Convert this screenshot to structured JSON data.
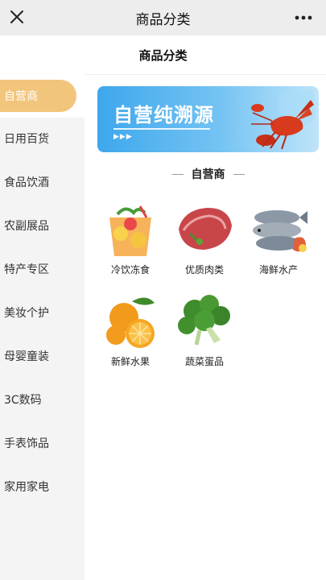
{
  "topbar": {
    "title": "商品分类"
  },
  "header": {
    "title": "商品分类"
  },
  "sidebar": {
    "items": [
      {
        "label": "自营商",
        "active": true
      },
      {
        "label": "日用百货"
      },
      {
        "label": "食品饮酒"
      },
      {
        "label": "农副展品"
      },
      {
        "label": "特产专区"
      },
      {
        "label": "美妆个护"
      },
      {
        "label": "母婴童装"
      },
      {
        "label": "3C数码"
      },
      {
        "label": "手表饰品"
      },
      {
        "label": "家用家电"
      }
    ]
  },
  "banner": {
    "text": "自营纯溯源",
    "arrows": "▶▶▶",
    "icon": "lobster-icon"
  },
  "section": {
    "title": "自营商"
  },
  "products": [
    {
      "label": "冷饮冻食",
      "icon": "iced-drink-icon"
    },
    {
      "label": "优质肉类",
      "icon": "meat-icon"
    },
    {
      "label": "海鲜水产",
      "icon": "fish-icon"
    },
    {
      "label": "新鲜水果",
      "icon": "orange-icon"
    },
    {
      "label": "蔬菜蛋品",
      "icon": "broccoli-icon"
    }
  ],
  "colors": {
    "accent": "#f2c57c",
    "banner": "#3ea7ec",
    "topbar": "#ededed",
    "sidebar": "#f4f4f4"
  }
}
